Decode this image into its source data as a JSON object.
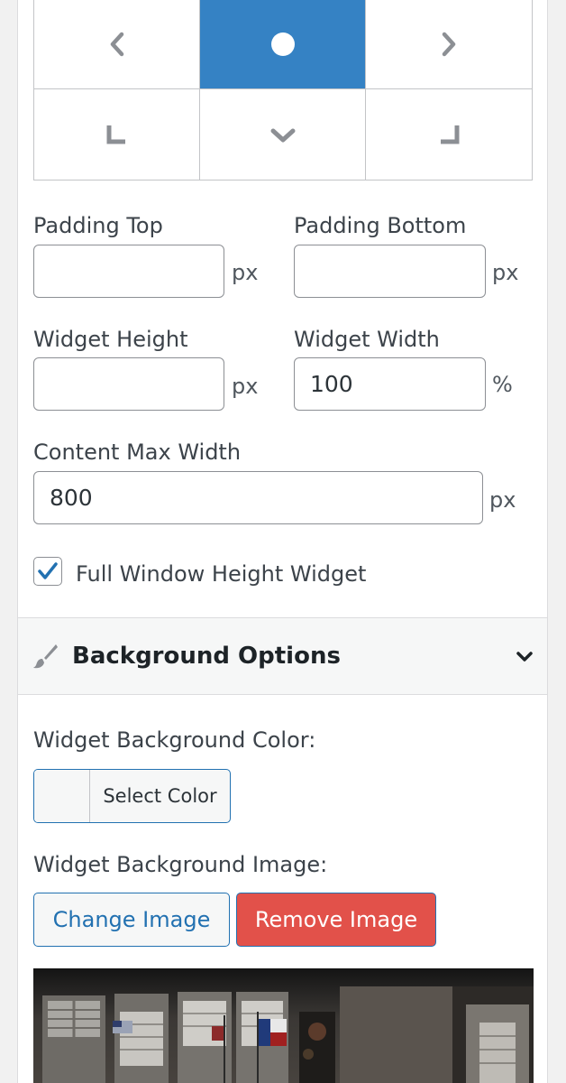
{
  "alignment": {
    "cells": [
      {
        "name": "align-left-icon",
        "active": false
      },
      {
        "name": "align-center-icon",
        "active": true
      },
      {
        "name": "align-right-icon",
        "active": false
      },
      {
        "name": "align-bottom-left-icon",
        "active": false
      },
      {
        "name": "align-bottom-center-icon",
        "active": false
      },
      {
        "name": "align-bottom-right-icon",
        "active": false
      }
    ],
    "active_color": "#3582c4",
    "icon_color": "#8c8f94"
  },
  "padding_top": {
    "label": "Padding Top",
    "value": "",
    "unit": "px"
  },
  "padding_bottom": {
    "label": "Padding Bottom",
    "value": "",
    "unit": "px"
  },
  "widget_height": {
    "label": "Widget Height",
    "value": "",
    "unit": "px"
  },
  "widget_width": {
    "label": "Widget Width",
    "value": "100",
    "unit": "%"
  },
  "content_max_width": {
    "label": "Content Max Width",
    "value": "800",
    "unit": "px"
  },
  "full_window": {
    "label": "Full Window Height Widget",
    "checked": true
  },
  "background_section": {
    "title": "Background Options",
    "icon": "paintbrush-icon",
    "toggle_icon": "chevron-down-icon"
  },
  "bg_color": {
    "label": "Widget Background Color:",
    "button_label": "Select Color",
    "swatch": "#f6f7f7"
  },
  "bg_image": {
    "label": "Widget Background Image:",
    "change_label": "Change Image",
    "remove_label": "Remove Image"
  },
  "colors": {
    "primary": "#2271b1",
    "danger": "#e2514a"
  }
}
